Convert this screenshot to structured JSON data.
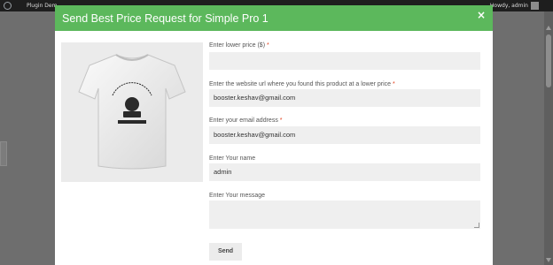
{
  "admin_bar": {
    "site_name": "Plugin Dem",
    "howdy": "Howdy, admin"
  },
  "modal": {
    "title": "Send Best Price Request for Simple Pro 1",
    "close_glyph": "×",
    "image_text": "WOOTHEMES",
    "fields": [
      {
        "label": "Enter lower price ($)",
        "required": true,
        "value": ""
      },
      {
        "label": "Enter the website url where you found this product at a lower price",
        "required": true,
        "value": "booster.keshav@gmail.com"
      },
      {
        "label": "Enter your email address",
        "required": true,
        "value": "booster.keshav@gmail.com"
      },
      {
        "label": "Enter Your name",
        "required": false,
        "value": "admin"
      },
      {
        "label": "Enter Your message",
        "required": false,
        "value": ""
      }
    ],
    "required_marker": "*",
    "send_label": "Send"
  },
  "colors": {
    "header": "#5cb85c",
    "required": "#e2401c",
    "input_bg": "#efefef"
  }
}
